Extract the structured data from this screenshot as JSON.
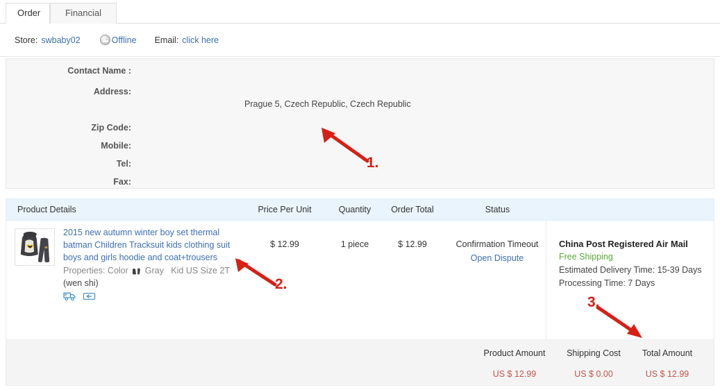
{
  "tabs": [
    {
      "label": "Order",
      "active": true
    },
    {
      "label": "Financial",
      "active": false
    }
  ],
  "store_bar": {
    "store_label": "Store:",
    "store_name": "swbaby02",
    "status_icon": "user-avatar-icon",
    "status_text": "Offline",
    "email_label": "Email:",
    "email_link": "click here"
  },
  "contact": {
    "rows": [
      {
        "key": "Contact Name :",
        "value": ""
      },
      {
        "key": "Address:",
        "value": ""
      },
      {
        "key": "Zip Code:",
        "value": ""
      },
      {
        "key": "Mobile:",
        "value": ""
      },
      {
        "key": "Tel:",
        "value": ""
      },
      {
        "key": "Fax:",
        "value": ""
      }
    ],
    "address_line": "Prague 5, Czech Republic, Czech Republic"
  },
  "table": {
    "headers": {
      "product": "Product Details",
      "price": "Price Per Unit",
      "quantity": "Quantity",
      "order_total": "Order Total",
      "status": "Status"
    },
    "row": {
      "thumbnail_icon": "product-thumbnail-batman-tracksuit",
      "title": "2015 new autumn winter boy set thermal batman Children Tracksuit kids clothing suit boys and girls hoodie and coat+trousers",
      "properties_prefix": "Properties: Color",
      "properties_color": "Gray",
      "properties_size": "Kid US Size 2T",
      "seller_note": "(wen shi)",
      "icons": [
        "shipping-truck-icon",
        "return-box-icon"
      ],
      "price_per_unit": "$ 12.99",
      "quantity": "1 piece",
      "order_total": "$ 12.99",
      "status": "Confirmation Timeout",
      "status_action": "Open Dispute"
    },
    "shipping": {
      "method": "China Post Registered Air Mail",
      "free_shipping": "Free Shipping",
      "estimated_delivery": "Estimated Delivery Time: 15-39 Days",
      "processing_time": "Processing Time: 7 Days"
    }
  },
  "footer": {
    "columns": [
      {
        "label": "Product Amount",
        "value": "US $ 12.99"
      },
      {
        "label": "Shipping Cost",
        "value": "US $ 0.00"
      },
      {
        "label": "Total Amount",
        "value": "US $ 12.99"
      }
    ]
  },
  "annotations": [
    {
      "number": "1.",
      "direction": "up-left"
    },
    {
      "number": "2.",
      "direction": "up-left"
    },
    {
      "number": "3.",
      "direction": "down-right"
    }
  ],
  "colors": {
    "link": "#3c6fb4",
    "annotation_red": "#d81f14",
    "amount_red": "#c4544a",
    "free_shipping_green": "#5aa83c",
    "table_header_bg": "#eaf4fc",
    "panel_bg": "#f7f7f7",
    "footer_bg": "#f4f4f4"
  }
}
